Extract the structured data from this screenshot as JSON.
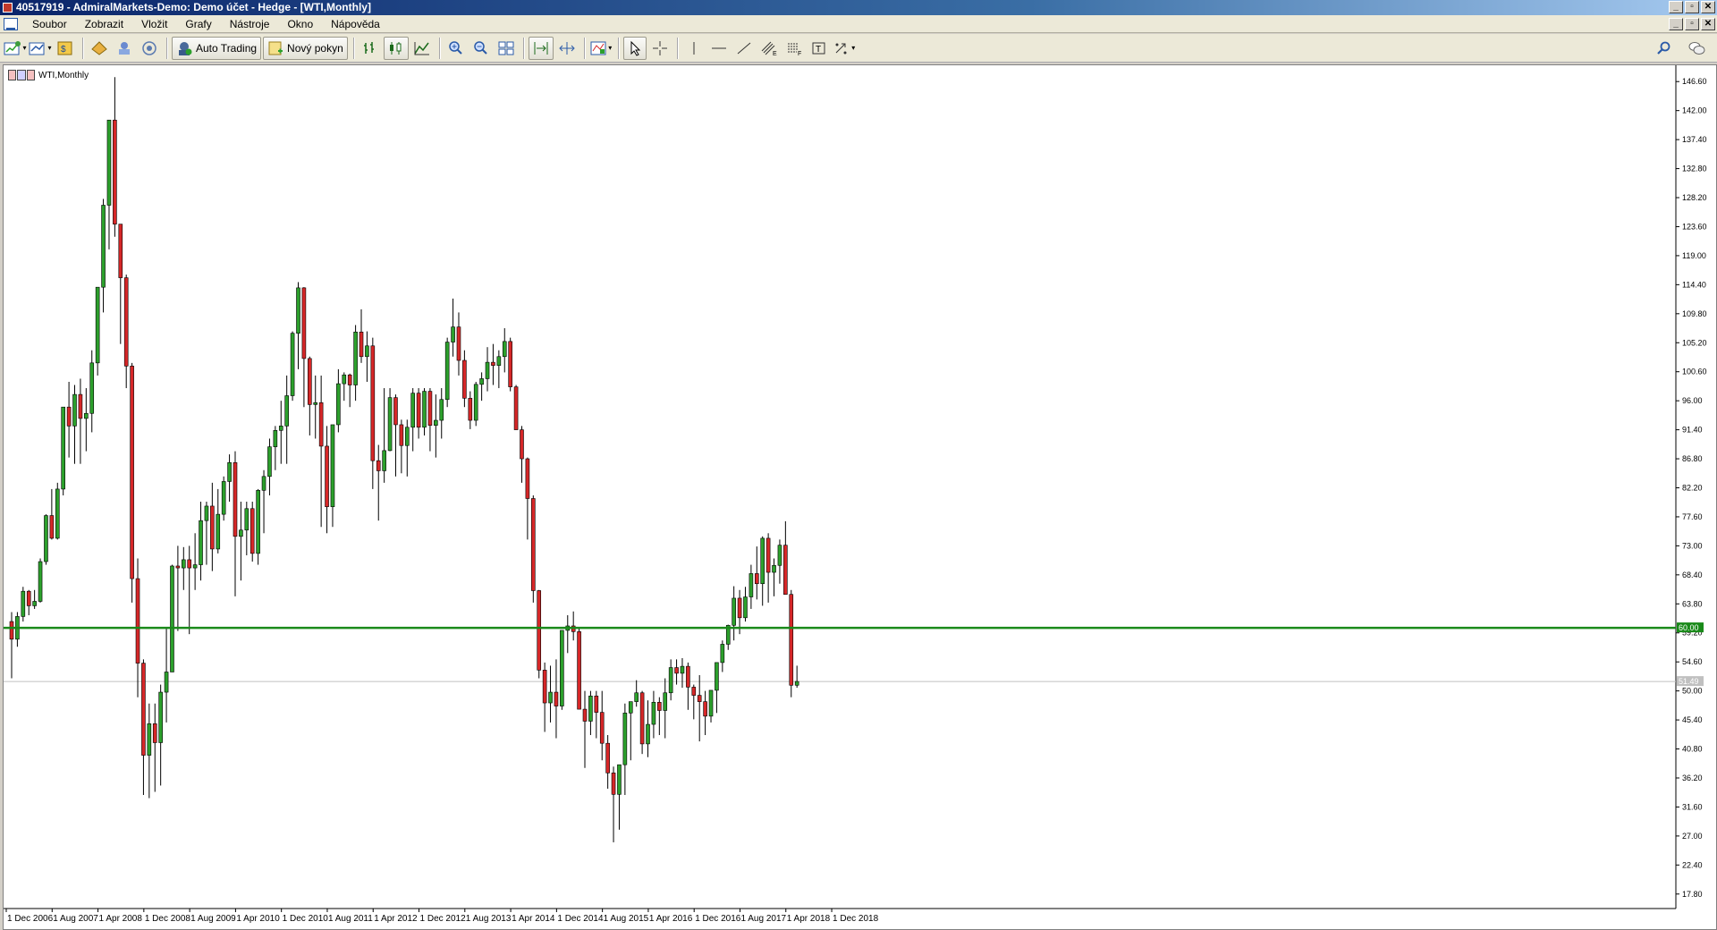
{
  "window": {
    "title": "40517919 - AdmiralMarkets-Demo: Demo účet - Hedge - [WTI,Monthly]"
  },
  "menu": [
    "Soubor",
    "Zobrazit",
    "Vložit",
    "Grafy",
    "Nástroje",
    "Okno",
    "Nápověda"
  ],
  "toolbar": {
    "auto_trading": "Auto Trading",
    "new_order": "Nový pokyn"
  },
  "chart": {
    "label": "WTI,Monthly",
    "bull_color": "#2ca02c",
    "bear_color": "#d62728"
  },
  "chart_data": {
    "type": "candlestick",
    "symbol": "WTI",
    "timeframe": "Monthly",
    "ylim": [
      15.5,
      148.9
    ],
    "yticks": [
      17.8,
      22.4,
      27.0,
      31.6,
      36.2,
      40.8,
      45.4,
      50.0,
      54.6,
      59.2,
      63.8,
      68.4,
      73.0,
      77.6,
      82.2,
      86.8,
      91.4,
      96.0,
      100.6,
      105.2,
      109.8,
      114.4,
      119.0,
      123.6,
      128.2,
      132.8,
      137.4,
      142.0,
      146.6
    ],
    "xtick_labels": [
      "1 Dec 2006",
      "1 Aug 2007",
      "1 Apr 2008",
      "1 Dec 2008",
      "1 Aug 2009",
      "1 Apr 2010",
      "1 Dec 2010",
      "1 Aug 2011",
      "1 Apr 2012",
      "1 Dec 2012",
      "1 Aug 2013",
      "1 Apr 2014",
      "1 Dec 2014",
      "1 Aug 2015",
      "1 Apr 2016",
      "1 Dec 2016",
      "1 Aug 2017",
      "1 Apr 2018",
      "1 Dec 2018"
    ],
    "horizontal_line": {
      "value": 60.0,
      "label": "60.00",
      "color": "#1a8a1a"
    },
    "current_price": {
      "value": 51.49,
      "label": "51.49"
    },
    "candles": [
      [
        61.0,
        62.5,
        52.0,
        58.2
      ],
      [
        58.2,
        62.5,
        57.0,
        61.8
      ],
      [
        61.8,
        66.5,
        61.0,
        65.8
      ],
      [
        65.8,
        66.0,
        62.0,
        63.5
      ],
      [
        63.5,
        66.0,
        63.0,
        64.2
      ],
      [
        64.2,
        71.0,
        64.0,
        70.5
      ],
      [
        70.5,
        78.0,
        70.0,
        77.8
      ],
      [
        77.8,
        82.0,
        74.0,
        74.2
      ],
      [
        74.2,
        83.0,
        74.0,
        82.0
      ],
      [
        82.0,
        95.0,
        81.0,
        95.0
      ],
      [
        95.0,
        99.0,
        87.0,
        92.0
      ],
      [
        92.0,
        98.5,
        86.0,
        97.0
      ],
      [
        97.0,
        99.5,
        86.0,
        93.2
      ],
      [
        93.2,
        98.0,
        88.0,
        94.0
      ],
      [
        94.0,
        104.0,
        91.0,
        102.0
      ],
      [
        102.0,
        113.0,
        100.0,
        114.0
      ],
      [
        114.0,
        128.0,
        110.0,
        127.0
      ],
      [
        127.0,
        140.0,
        120.0,
        140.5
      ],
      [
        140.5,
        147.3,
        122.0,
        124.0
      ],
      [
        124.0,
        122.0,
        105.0,
        115.5
      ],
      [
        115.5,
        116.0,
        98.0,
        101.5
      ],
      [
        101.5,
        102.0,
        64.0,
        67.8
      ],
      [
        67.8,
        71.0,
        49.0,
        54.4
      ],
      [
        54.4,
        55.0,
        33.5,
        39.8
      ],
      [
        39.8,
        48.0,
        33.0,
        44.8
      ],
      [
        44.8,
        48.0,
        34.0,
        41.8
      ],
      [
        41.8,
        51.0,
        35.0,
        49.8
      ],
      [
        49.8,
        60.0,
        45.0,
        53.0
      ],
      [
        53.0,
        70.0,
        53.0,
        69.8
      ],
      [
        69.8,
        73.0,
        59.5,
        69.5
      ],
      [
        69.5,
        72.8,
        66.0,
        70.8
      ],
      [
        70.8,
        73.0,
        59.0,
        69.5
      ],
      [
        69.5,
        75.0,
        66.0,
        70.0
      ],
      [
        70.0,
        80.0,
        67.5,
        77.0
      ],
      [
        77.0,
        80.0,
        70.0,
        79.3
      ],
      [
        79.3,
        83.0,
        69.0,
        72.5
      ],
      [
        72.5,
        82.0,
        71.8,
        78.0
      ],
      [
        78.0,
        84.0,
        77.0,
        83.2
      ],
      [
        83.2,
        87.5,
        80.0,
        86.2
      ],
      [
        86.2,
        88.0,
        65.0,
        74.5
      ],
      [
        74.5,
        80.0,
        67.5,
        75.5
      ],
      [
        75.5,
        80.0,
        71.5,
        78.9
      ],
      [
        78.9,
        80.0,
        70.5,
        71.8
      ],
      [
        71.8,
        82.0,
        70.0,
        81.8
      ],
      [
        81.8,
        85.0,
        75.0,
        84.0
      ],
      [
        84.0,
        90.0,
        81.0,
        88.7
      ],
      [
        88.7,
        92.0,
        85.0,
        91.3
      ],
      [
        91.3,
        96.0,
        86.0,
        92.0
      ],
      [
        92.0,
        100.0,
        86.0,
        96.8
      ],
      [
        96.8,
        107.0,
        96.0,
        106.7
      ],
      [
        106.7,
        114.8,
        101.0,
        113.9
      ],
      [
        113.9,
        114.0,
        95.0,
        102.7
      ],
      [
        102.7,
        103.0,
        90.5,
        95.4
      ],
      [
        95.4,
        100.0,
        90.0,
        95.7
      ],
      [
        95.7,
        100.0,
        76.0,
        88.8
      ],
      [
        88.8,
        92.0,
        75.0,
        79.2
      ],
      [
        79.2,
        90.0,
        76.0,
        92.2
      ],
      [
        92.2,
        101.0,
        91.0,
        98.7
      ],
      [
        98.7,
        100.5,
        96.0,
        100.1
      ],
      [
        100.1,
        100.3,
        95.0,
        98.5
      ],
      [
        98.5,
        108.0,
        96.0,
        106.9
      ],
      [
        106.9,
        110.5,
        102.0,
        103.0
      ],
      [
        103.0,
        107.0,
        99.0,
        104.7
      ],
      [
        104.7,
        106.0,
        82.0,
        86.5
      ],
      [
        86.5,
        89.0,
        77.0,
        84.9
      ],
      [
        84.9,
        98.0,
        83.0,
        88.1
      ],
      [
        88.1,
        98.0,
        88.0,
        96.5
      ],
      [
        96.5,
        97.0,
        84.0,
        92.2
      ],
      [
        92.2,
        93.0,
        84.5,
        88.9
      ],
      [
        88.9,
        93.0,
        84.0,
        91.8
      ],
      [
        91.8,
        98.0,
        88.0,
        97.2
      ],
      [
        97.2,
        98.0,
        90.0,
        91.8
      ],
      [
        91.8,
        98.0,
        90.5,
        97.5
      ],
      [
        97.5,
        98.0,
        88.0,
        92.1
      ],
      [
        92.1,
        97.0,
        87.0,
        92.9
      ],
      [
        92.9,
        98.0,
        90.0,
        96.2
      ],
      [
        96.2,
        106.0,
        95.0,
        105.3
      ],
      [
        105.3,
        112.2,
        103.0,
        107.7
      ],
      [
        107.7,
        110.0,
        100.0,
        102.4
      ],
      [
        102.4,
        104.0,
        95.0,
        96.4
      ],
      [
        96.4,
        97.5,
        91.5,
        92.9
      ],
      [
        92.9,
        99.0,
        92.0,
        98.6
      ],
      [
        98.6,
        100.5,
        96.0,
        99.5
      ],
      [
        99.5,
        104.5,
        97.5,
        102.1
      ],
      [
        102.1,
        105.0,
        98.5,
        101.6
      ],
      [
        101.6,
        104.0,
        98.0,
        103.0
      ],
      [
        103.0,
        107.5,
        100.5,
        105.4
      ],
      [
        105.4,
        106.0,
        97.5,
        98.2
      ],
      [
        98.2,
        98.5,
        92.5,
        91.4
      ],
      [
        91.4,
        92.0,
        83.0,
        86.8
      ],
      [
        86.8,
        87.0,
        74.0,
        80.5
      ],
      [
        80.5,
        81.0,
        64.0,
        65.9
      ],
      [
        65.9,
        66.0,
        52.0,
        53.3
      ],
      [
        53.3,
        54.5,
        43.5,
        48.1
      ],
      [
        48.1,
        54.0,
        45.0,
        49.8
      ],
      [
        49.8,
        55.0,
        42.5,
        47.6
      ],
      [
        47.6,
        59.0,
        47.0,
        59.6
      ],
      [
        59.6,
        62.0,
        56.0,
        60.3
      ],
      [
        60.3,
        62.6,
        58.0,
        59.4
      ],
      [
        59.4,
        60.0,
        50.0,
        47.1
      ],
      [
        47.1,
        50.0,
        37.8,
        45.2
      ],
      [
        45.2,
        50.0,
        43.0,
        49.2
      ],
      [
        49.2,
        50.0,
        42.5,
        46.6
      ],
      [
        46.6,
        50.0,
        39.0,
        41.7
      ],
      [
        41.7,
        43.0,
        34.5,
        37.0
      ],
      [
        37.0,
        38.0,
        26.0,
        33.6
      ],
      [
        33.6,
        38.0,
        28.0,
        38.3
      ],
      [
        38.3,
        48.0,
        33.5,
        46.5
      ],
      [
        46.5,
        48.0,
        39.0,
        48.3
      ],
      [
        48.3,
        51.7,
        47.5,
        49.7
      ],
      [
        49.7,
        50.0,
        40.0,
        41.6
      ],
      [
        41.6,
        48.5,
        39.5,
        44.7
      ],
      [
        44.7,
        50.0,
        42.5,
        48.2
      ],
      [
        48.2,
        49.0,
        43.0,
        46.9
      ],
      [
        46.9,
        52.0,
        42.5,
        49.7
      ],
      [
        49.7,
        55.0,
        48.5,
        53.7
      ],
      [
        53.7,
        55.0,
        51.0,
        52.8
      ],
      [
        52.8,
        55.2,
        50.5,
        53.9
      ],
      [
        53.9,
        54.5,
        47.0,
        50.6
      ],
      [
        50.6,
        51.0,
        45.5,
        49.3
      ],
      [
        49.3,
        52.5,
        42.0,
        48.3
      ],
      [
        48.3,
        50.0,
        43.0,
        46.0
      ],
      [
        46.0,
        50.0,
        45.0,
        50.1
      ],
      [
        50.1,
        54.0,
        46.5,
        54.5
      ],
      [
        54.5,
        58.0,
        53.0,
        57.4
      ],
      [
        57.4,
        60.5,
        56.5,
        60.4
      ],
      [
        60.4,
        66.6,
        58.0,
        64.7
      ],
      [
        64.7,
        66.0,
        59.0,
        61.6
      ],
      [
        61.6,
        66.5,
        61.0,
        64.9
      ],
      [
        64.9,
        70.0,
        63.0,
        68.6
      ],
      [
        68.6,
        72.9,
        64.5,
        67.0
      ],
      [
        67.0,
        74.5,
        63.5,
        74.2
      ],
      [
        74.2,
        75.0,
        64.0,
        68.8
      ],
      [
        68.8,
        71.0,
        65.0,
        69.9
      ],
      [
        69.9,
        74.0,
        67.0,
        73.1
      ],
      [
        73.1,
        76.9,
        69.0,
        65.3
      ],
      [
        65.3,
        66.0,
        49.0,
        50.9
      ],
      [
        50.9,
        54.0,
        50.5,
        51.5
      ]
    ]
  }
}
